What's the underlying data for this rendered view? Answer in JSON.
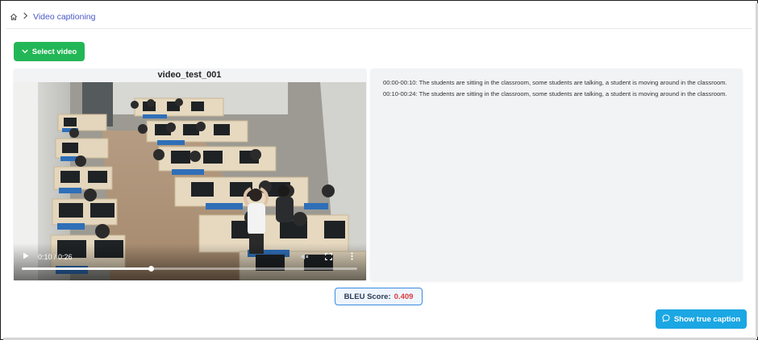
{
  "breadcrumb": {
    "home_icon": "home-icon",
    "separator_icon": "chevron-right-icon",
    "current": "Video captioning"
  },
  "select_video": {
    "label": "Select video",
    "icon": "chevron-down-icon"
  },
  "video": {
    "title": "video_test_001",
    "current_time": "0:10",
    "duration": "0:26",
    "time_display": "0:10 / 0:26",
    "progress_fraction": 0.385
  },
  "captions": [
    "00:00-00:10: The students are sitting in the classroom, some students are talking, a student is moving around in the classroom.",
    "00:10-00:24: The students are sitting in the classroom, some students are talking, a student is moving around in the classroom."
  ],
  "bleu": {
    "label": "BLEU Score:",
    "value": "0.409"
  },
  "show_true_caption": {
    "label": "Show true caption",
    "icon": "chat-bubble-icon"
  },
  "colors": {
    "select_button": "#22b756",
    "show_button": "#1ba7e3",
    "bleu_value": "#d93b3b",
    "breadcrumb_link": "#4a58c8"
  }
}
